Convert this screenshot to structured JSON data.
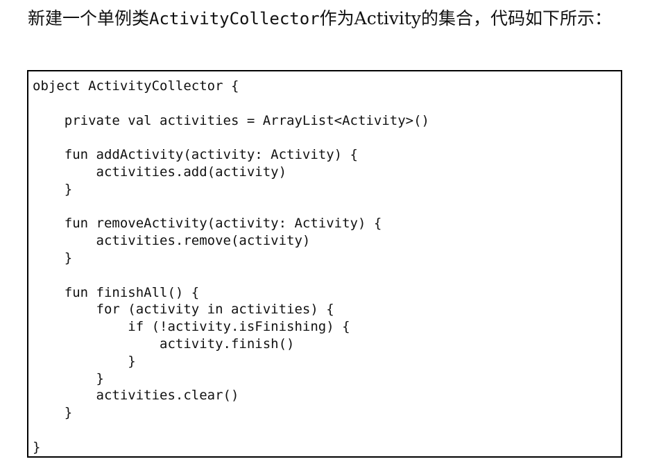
{
  "intro": {
    "text_before": "新建一个单例类",
    "class_name": "ActivityCollector",
    "text_after": "作为Activity的集合，代码如下所示："
  },
  "code": {
    "lines": [
      "object ActivityCollector {",
      "",
      "    private val activities = ArrayList<Activity>()",
      "",
      "    fun addActivity(activity: Activity) {",
      "        activities.add(activity)",
      "    }",
      "",
      "    fun removeActivity(activity: Activity) {",
      "        activities.remove(activity)",
      "    }",
      "",
      "    fun finishAll() {",
      "        for (activity in activities) {",
      "            if (!activity.isFinishing) {",
      "                activity.finish()",
      "            }",
      "        }",
      "        activities.clear()",
      "    }",
      "",
      "}"
    ]
  }
}
